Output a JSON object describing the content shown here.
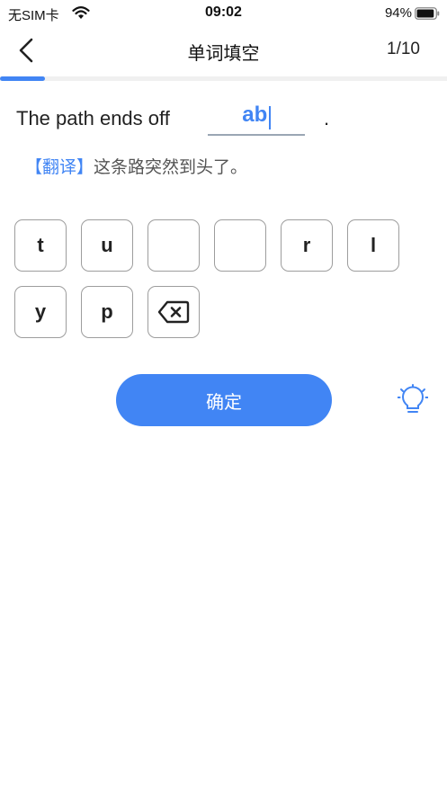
{
  "status_bar": {
    "carrier": "无SIM卡",
    "time": "09:02",
    "battery": "94%",
    "battery_level": 0.94
  },
  "nav": {
    "title": "单词填空",
    "counter": "1/10",
    "back_icon": "chevron-left-icon"
  },
  "progress": {
    "current": 1,
    "total": 10
  },
  "question": {
    "sentence": "The path ends off",
    "answer": "ab",
    "ending": ".",
    "translation_tag": "【翻译】",
    "translation": "这条路突然到头了。"
  },
  "keyboard": {
    "keys": [
      "t",
      "u",
      "",
      "",
      "r",
      "l",
      "y",
      "p"
    ],
    "delete_icon": "backspace-icon"
  },
  "actions": {
    "confirm_label": "确定",
    "hint_icon": "lightbulb-icon"
  },
  "colors": {
    "accent": "#4185f4",
    "key_border": "#9d9d9d",
    "progress_track": "#f0f0f0"
  }
}
